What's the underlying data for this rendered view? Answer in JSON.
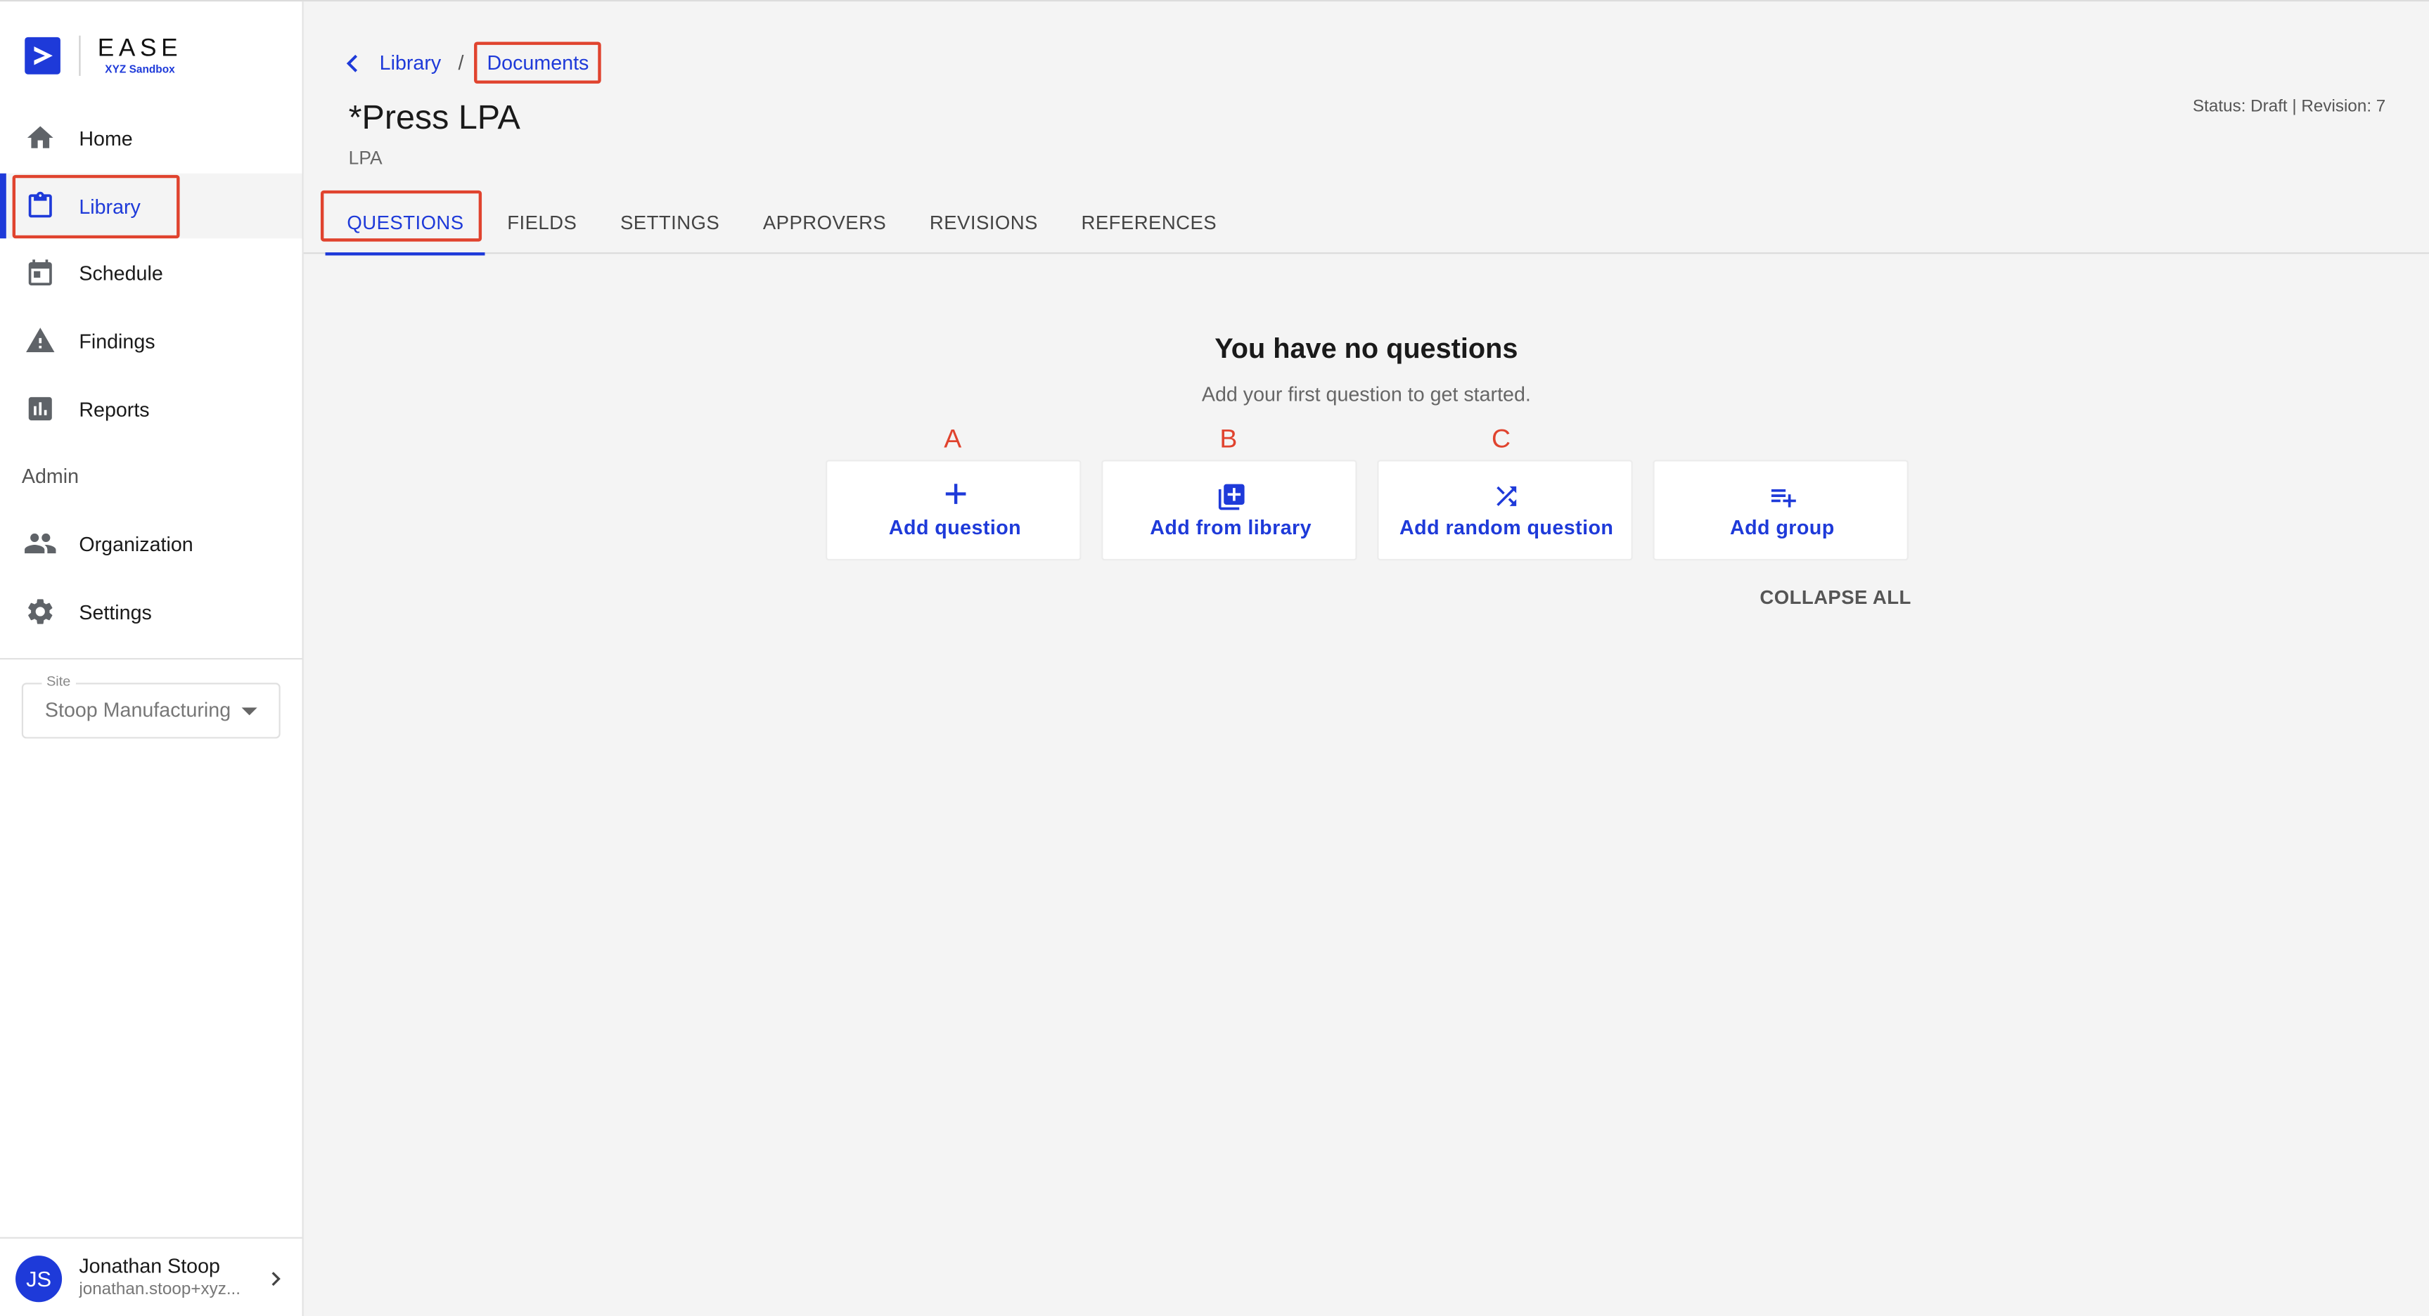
{
  "brand": {
    "name": "EASE",
    "workspace": "XYZ Sandbox"
  },
  "sidebar": {
    "items": [
      {
        "label": "Home",
        "icon": "home-icon"
      },
      {
        "label": "Library",
        "icon": "clipboard-icon",
        "active": true
      },
      {
        "label": "Schedule",
        "icon": "calendar-icon"
      },
      {
        "label": "Findings",
        "icon": "warning-icon"
      },
      {
        "label": "Reports",
        "icon": "bar-chart-icon"
      }
    ],
    "admin_label": "Admin",
    "admin_items": [
      {
        "label": "Organization",
        "icon": "people-icon"
      },
      {
        "label": "Settings",
        "icon": "gear-icon"
      }
    ],
    "site": {
      "label": "Site",
      "value": "Stoop Manufacturing"
    },
    "user": {
      "initials": "JS",
      "name": "Jonathan Stoop",
      "email": "jonathan.stoop+xyz..."
    }
  },
  "breadcrumb": {
    "parent": "Library",
    "separator": "/",
    "current": "Documents"
  },
  "document": {
    "title": "*Press LPA",
    "subtitle": "LPA",
    "status": "Status: Draft | Revision: 7"
  },
  "tabs": [
    {
      "label": "QUESTIONS",
      "active": true
    },
    {
      "label": "FIELDS"
    },
    {
      "label": "SETTINGS"
    },
    {
      "label": "APPROVERS"
    },
    {
      "label": "REVISIONS"
    },
    {
      "label": "REFERENCES"
    }
  ],
  "empty_state": {
    "title": "You have no questions",
    "subtitle": "Add your first question to get started."
  },
  "markers": [
    "A",
    "B",
    "C"
  ],
  "actions": [
    {
      "label": "Add question",
      "icon": "plus-icon"
    },
    {
      "label": "Add from library",
      "icon": "library-add-icon"
    },
    {
      "label": "Add random question",
      "icon": "shuffle-icon"
    },
    {
      "label": "Add group",
      "icon": "playlist-add-icon"
    }
  ],
  "collapse_all_label": "COLLAPSE ALL",
  "colors": {
    "accent": "#1e3ad9",
    "annotation": "#e0432e",
    "background": "#f4f4f4"
  }
}
